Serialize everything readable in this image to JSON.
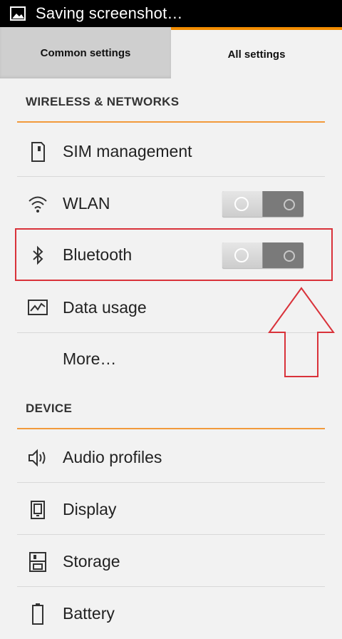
{
  "status_bar": {
    "text": "Saving screenshot…",
    "icon": "image-icon"
  },
  "tabs": [
    {
      "label": "Common settings",
      "active": false
    },
    {
      "label": "All settings",
      "active": true
    }
  ],
  "sections": {
    "wireless": {
      "title": "WIRELESS & NETWORKS"
    },
    "device": {
      "title": "DEVICE"
    }
  },
  "items": {
    "sim": {
      "label": "SIM management",
      "icon": "sim-card-icon"
    },
    "wlan": {
      "label": "WLAN",
      "icon": "wifi-icon",
      "toggle": "off"
    },
    "bluetooth": {
      "label": "Bluetooth",
      "icon": "bluetooth-icon",
      "toggle": "off"
    },
    "data_usage": {
      "label": "Data usage",
      "icon": "chart-icon"
    },
    "more": {
      "label": "More…"
    },
    "audio": {
      "label": "Audio profiles",
      "icon": "speaker-icon"
    },
    "display": {
      "label": "Display",
      "icon": "display-icon"
    },
    "storage": {
      "label": "Storage",
      "icon": "storage-icon"
    },
    "battery": {
      "label": "Battery",
      "icon": "battery-icon"
    }
  },
  "colors": {
    "accent": "#f28c00",
    "highlight": "#d9323a",
    "status_bar": "#000000"
  }
}
